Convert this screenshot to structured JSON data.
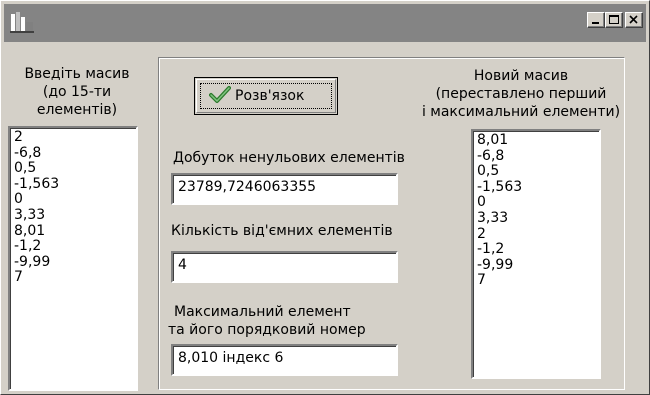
{
  "window": {
    "title": ""
  },
  "titlebar_buttons": {
    "minimize_icon": "minimize-icon",
    "maximize_icon": "maximize-icon",
    "close_icon": "close-icon"
  },
  "input_section": {
    "label_line1": "Введіть масив",
    "label_line2": "(до 15-ти",
    "label_line3": "елементів)",
    "items": [
      "2",
      "-6,8",
      "0,5",
      "-1,563",
      "0",
      "3,33",
      "8,01",
      "-1,2",
      "-9,99",
      "7"
    ]
  },
  "solve_button": {
    "label": "Розв'язок",
    "icon": "checkmark-icon"
  },
  "product": {
    "label": "Добуток  ненульових елементів",
    "value": "23789,7246063355"
  },
  "negatives": {
    "label": "Кількість від'ємних  елементів",
    "value": "4"
  },
  "max_element": {
    "label_line1": "Максимальний елемент",
    "label_line2": "та його порядковий номер",
    "value": "8,010 індекс 6"
  },
  "output_section": {
    "label_line1": "Новий масив",
    "label_line2": "(переставлено перший",
    "label_line3": "і максимальний елементи)",
    "items": [
      "8,01",
      "-6,8",
      "0,5",
      "-1,563",
      "0",
      "3,33",
      "2",
      "-1,2",
      "-9,99",
      "7"
    ]
  },
  "colors": {
    "titlebar": "#848484",
    "face": "#d4d0c8",
    "check": "#3c8c3c"
  }
}
